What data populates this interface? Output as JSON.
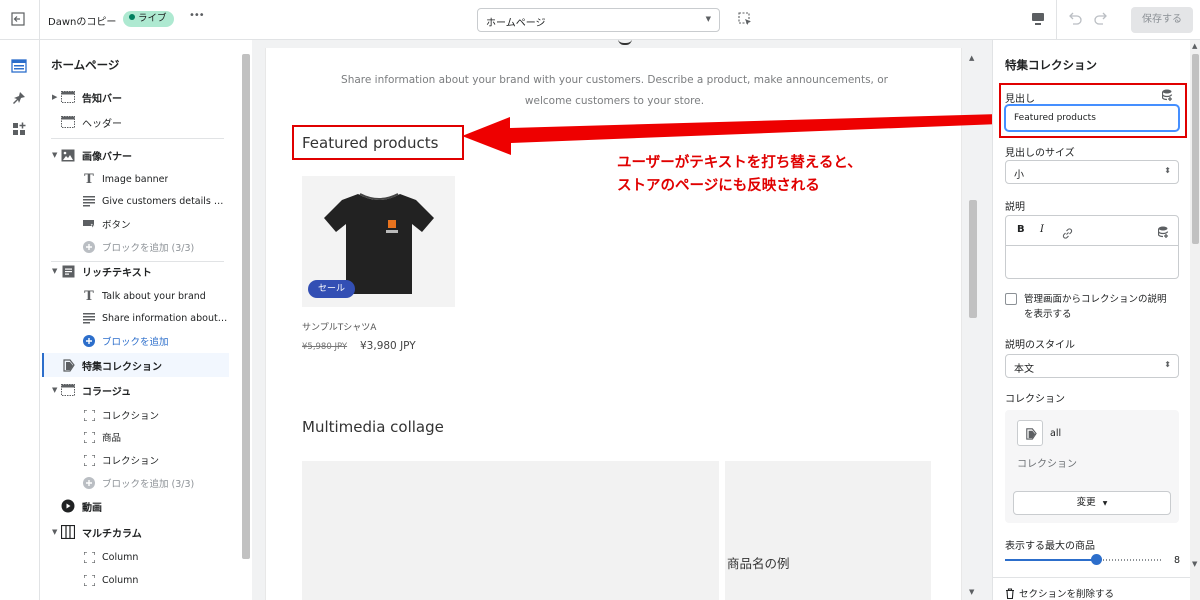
{
  "topbar": {
    "store_name": "Dawnのコピー",
    "status_badge": "ライブ",
    "more": "•••",
    "page_selector": "ホームページ",
    "save_label": "保存する"
  },
  "sidebar": {
    "title": "ホームページ",
    "items": [
      {
        "label": "告知バー"
      },
      {
        "label": "ヘッダー"
      },
      {
        "label": "画像バナー"
      },
      {
        "label": "Image banner"
      },
      {
        "label": "Give customers details abo..."
      },
      {
        "label": "ボタン"
      },
      {
        "label": "ブロックを追加 (3/3)"
      },
      {
        "label": "リッチテキスト"
      },
      {
        "label": "Talk about your brand"
      },
      {
        "label": "Share information about y..."
      },
      {
        "label": "ブロックを追加"
      },
      {
        "label": "特集コレクション"
      },
      {
        "label": "コラージュ"
      },
      {
        "label": "コレクション"
      },
      {
        "label": "商品"
      },
      {
        "label": "コレクション"
      },
      {
        "label": "ブロックを追加 (3/3)"
      },
      {
        "label": "動画"
      },
      {
        "label": "マルチカラム"
      },
      {
        "label": "Column"
      },
      {
        "label": "Column"
      }
    ]
  },
  "preview": {
    "rich_text_line1": "Share information about your brand with your customers. Describe a product, make announcements, or",
    "rich_text_line2": "welcome customers to your store.",
    "featured_heading": "Featured products",
    "sale_badge": "セール",
    "product_name": "サンプルTシャツA",
    "price_old": "¥5,980 JPY",
    "price_new": "¥3,980 JPY",
    "collage_heading": "Multimedia collage",
    "collage_product_name": "商品名の例"
  },
  "annotation": {
    "line1": "ユーザーがテキストを打ち替えると、",
    "line2": "ストアのページにも反映される",
    "color": "#e00000"
  },
  "right_panel": {
    "title": "特集コレクション",
    "heading_label": "見出し",
    "heading_value": "Featured products",
    "heading_size_label": "見出しのサイズ",
    "heading_size_value": "小",
    "description_label": "説明",
    "rte_bold": "B",
    "rte_italic": "I",
    "checkbox_line1": "管理画面からコレクションの説明",
    "checkbox_line2": "を表示する",
    "desc_style_label": "説明のスタイル",
    "desc_style_value": "本文",
    "collection_label": "コレクション",
    "collection_name": "all",
    "collection_sub": "コレクション",
    "change_button": "変更",
    "max_products_label": "表示する最大の商品",
    "max_products_value": "8",
    "delete_section": "セクションを削除する"
  }
}
